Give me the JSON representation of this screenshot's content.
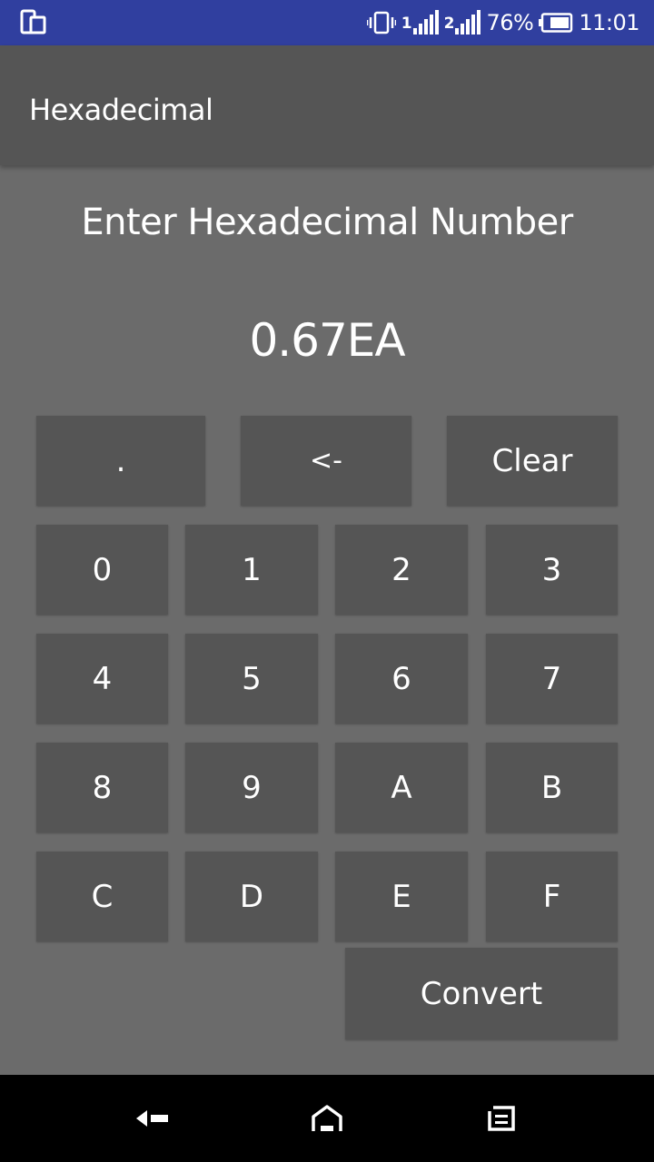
{
  "status_bar": {
    "battery_percent": "76%",
    "time": "11:01",
    "sim1_label": "1",
    "sim2_label": "2",
    "icons": [
      "dual-screen-icon",
      "vibrate-icon",
      "signal-icon",
      "signal-icon",
      "battery-icon"
    ]
  },
  "toolbar": {
    "title": "Hexadecimal"
  },
  "main": {
    "prompt": "Enter Hexadecimal Number",
    "value": "0.67EA"
  },
  "keypad": {
    "dot": ".",
    "backspace": "<-",
    "clear": "Clear",
    "digits": [
      "0",
      "1",
      "2",
      "3",
      "4",
      "5",
      "6",
      "7",
      "8",
      "9",
      "A",
      "B",
      "C",
      "D",
      "E",
      "F"
    ],
    "convert": "Convert"
  },
  "nav_bar": {
    "icons": [
      "back-icon",
      "home-icon",
      "recent-apps-icon"
    ]
  },
  "colors": {
    "status_bar": "#303f9f",
    "toolbar": "#555555",
    "background": "#6b6b6b",
    "key": "#555555",
    "nav_bar": "#000000"
  }
}
